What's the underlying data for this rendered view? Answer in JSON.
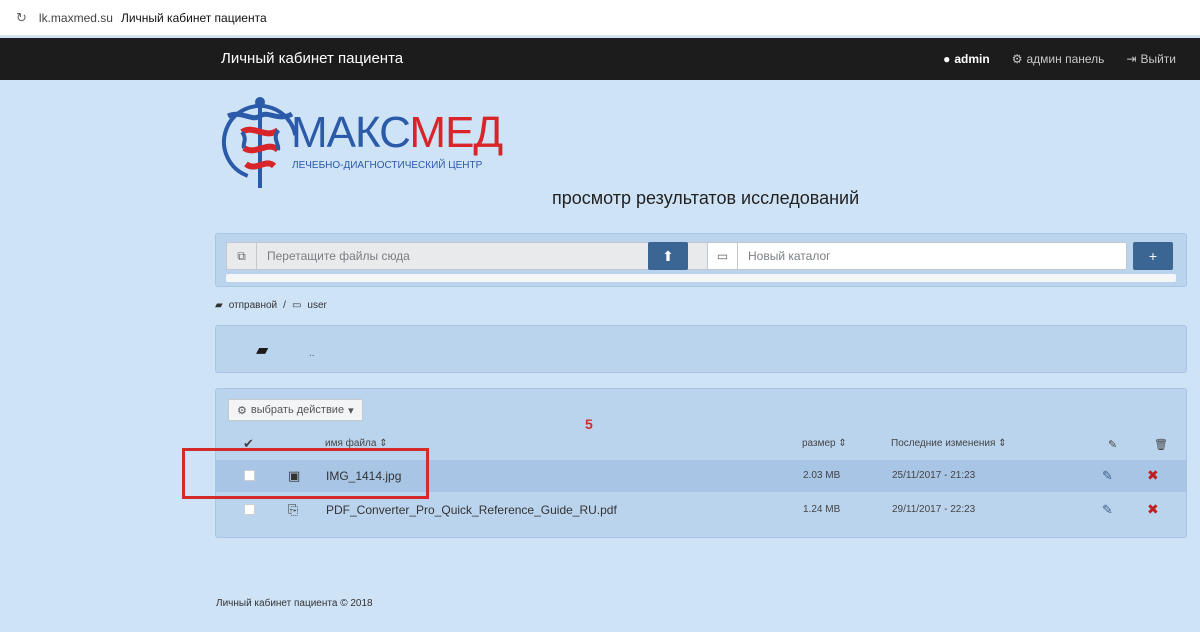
{
  "browser": {
    "url": "lk.maxmed.su",
    "page_title": "Личный кабинет пациента"
  },
  "navbar": {
    "brand": "Личный кабинет пациента",
    "user": "admin",
    "admin_panel": "админ панель",
    "logout": "Выйти"
  },
  "logo": {
    "name_part1": "МАКС",
    "name_part2": "МЕД",
    "subtitle": "ЛЕЧЕБНО-ДИАГНОСТИЧЕСКИЙ ЦЕНТР",
    "colors": {
      "blue": "#2a5aa8",
      "red": "#d8252a"
    }
  },
  "heading": "просмотр результатов исследований",
  "upload": {
    "drop_placeholder": "Перетащите файлы сюда",
    "new_folder_placeholder": "Новый каталог"
  },
  "breadcrumb": {
    "root": "отправной",
    "separator": "/",
    "current": "user"
  },
  "parent_dir": {
    "label": ".."
  },
  "files": {
    "action_button": "выбрать действие",
    "annotation": "5",
    "columns": {
      "name": "имя файла",
      "size": "размер",
      "modified": "Последние изменения"
    },
    "rows": [
      {
        "name": "IMG_1414.jpg",
        "size": "2.03 MB",
        "modified": "25/11/2017 - 21:23",
        "type_icon": "image-icon"
      },
      {
        "name": "PDF_Converter_Pro_Quick_Reference_Guide_RU.pdf",
        "size": "1.24 MB",
        "modified": "29/11/2017 - 22:23",
        "type_icon": "pdf-file-icon"
      }
    ]
  },
  "footer": "Личный кабинет пациента © 2018",
  "colors": {
    "navbar": "#1c1c1c",
    "background": "#cfe3f7",
    "button": "#3b6592",
    "highlight_box": "#d52a2a",
    "delete": "#c0201d"
  }
}
